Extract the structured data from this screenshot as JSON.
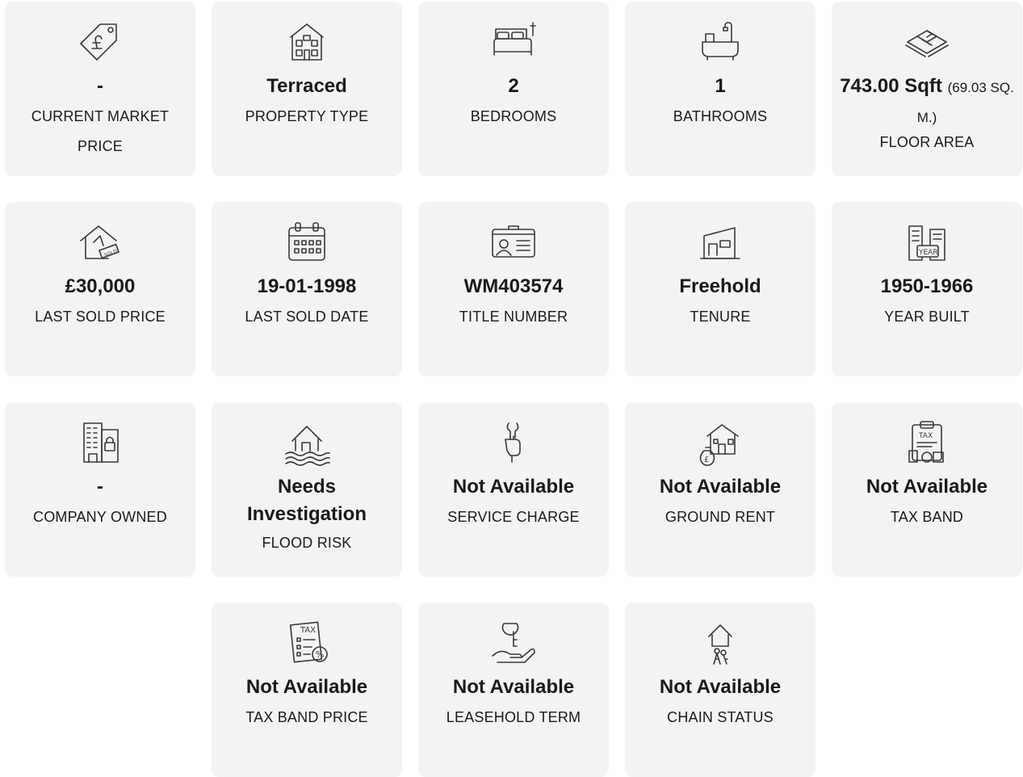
{
  "cards": [
    {
      "icon": "price-tag-pound-icon",
      "value": "-",
      "label": "CURRENT MARKET PRICE"
    },
    {
      "icon": "townhouse-icon",
      "value": "Terraced",
      "label": "PROPERTY TYPE"
    },
    {
      "icon": "bed-icon",
      "value": "2",
      "label": "BEDROOMS"
    },
    {
      "icon": "bathtub-icon",
      "value": "1",
      "label": "BATHROOMS"
    },
    {
      "icon": "floor-plan-icon",
      "value": "743.00 Sqft",
      "value_sub": "(69.03 SQ. M.)",
      "label": "FLOOR AREA"
    },
    {
      "icon": "sold-house-icon",
      "value": "£30,000",
      "label": "LAST SOLD PRICE"
    },
    {
      "icon": "calendar-icon",
      "value": "19-01-1998",
      "label": "LAST SOLD DATE"
    },
    {
      "icon": "id-card-icon",
      "value": "WM403574",
      "label": "TITLE NUMBER"
    },
    {
      "icon": "freehold-house-icon",
      "value": "Freehold",
      "label": "TENURE"
    },
    {
      "icon": "year-building-icon",
      "value": "1950-1966",
      "label": "YEAR BUILT"
    },
    {
      "icon": "company-building-lock-icon",
      "value": "-",
      "label": "COMPANY OWNED"
    },
    {
      "icon": "flood-house-icon",
      "value": "Needs Investigation",
      "label": "FLOOD RISK"
    },
    {
      "icon": "wrench-hand-icon",
      "value": "Not Available",
      "label": "SERVICE CHARGE"
    },
    {
      "icon": "house-money-bag-icon",
      "value": "Not Available",
      "label": "GROUND RENT"
    },
    {
      "icon": "tax-clipboard-icon",
      "value": "Not Available",
      "label": "TAX BAND"
    },
    {
      "icon": "tax-document-percent-icon",
      "value": "Not Available",
      "label": "TAX BAND PRICE"
    },
    {
      "icon": "key-hand-icon",
      "value": "Not Available",
      "label": "LEASEHOLD TERM"
    },
    {
      "icon": "house-keys-icon",
      "value": "Not Available",
      "label": "CHAIN STATUS"
    }
  ]
}
